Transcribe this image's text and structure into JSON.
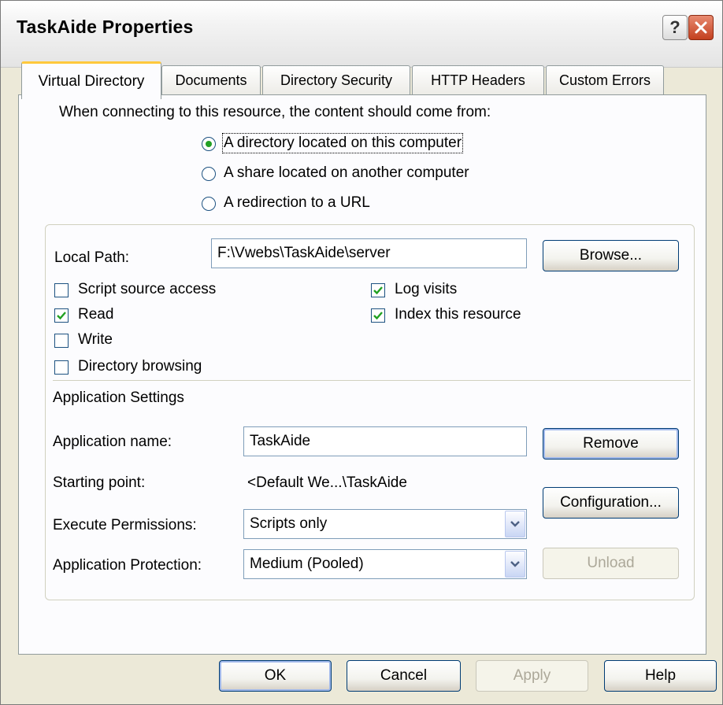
{
  "window": {
    "title": "TaskAide Properties"
  },
  "tabs": [
    {
      "label": "Virtual Directory",
      "active": true
    },
    {
      "label": "Documents"
    },
    {
      "label": "Directory Security"
    },
    {
      "label": "HTTP Headers"
    },
    {
      "label": "Custom Errors"
    }
  ],
  "content_source": {
    "prompt": "When connecting to this resource, the content should come from:",
    "options": [
      {
        "label": "A directory located on this computer",
        "selected": true
      },
      {
        "label": "A share located on another computer",
        "selected": false
      },
      {
        "label": "A redirection to a URL",
        "selected": false
      }
    ]
  },
  "local_path": {
    "label": "Local Path:",
    "value": "F:\\Vwebs\\TaskAide\\server",
    "browse_label": "Browse..."
  },
  "permissions": {
    "script_source_access": {
      "label": "Script source access",
      "checked": false
    },
    "read": {
      "label": "Read",
      "checked": true
    },
    "write": {
      "label": "Write",
      "checked": false
    },
    "directory_browsing": {
      "label": "Directory browsing",
      "checked": false
    },
    "log_visits": {
      "label": "Log visits",
      "checked": true
    },
    "index_resource": {
      "label": "Index this resource",
      "checked": true
    }
  },
  "app_settings": {
    "heading": "Application Settings",
    "name_label": "Application name:",
    "name_value": "TaskAide",
    "remove_label": "Remove",
    "starting_point_label": "Starting point:",
    "starting_point_value": "<Default We...\\TaskAide",
    "configuration_label": "Configuration...",
    "execute_label": "Execute Permissions:",
    "execute_value": "Scripts only",
    "protection_label": "Application Protection:",
    "protection_value": "Medium (Pooled)",
    "unload_label": "Unload"
  },
  "footer": {
    "ok_label": "OK",
    "cancel_label": "Cancel",
    "apply_label": "Apply",
    "help_label": "Help"
  },
  "colors": {
    "dialog_bg": "#ece9d8",
    "panel_bg": "#fcfcfe",
    "active_tab_accent": "#ffc83c",
    "check_green": "#21a121",
    "button_border": "#003c74"
  }
}
